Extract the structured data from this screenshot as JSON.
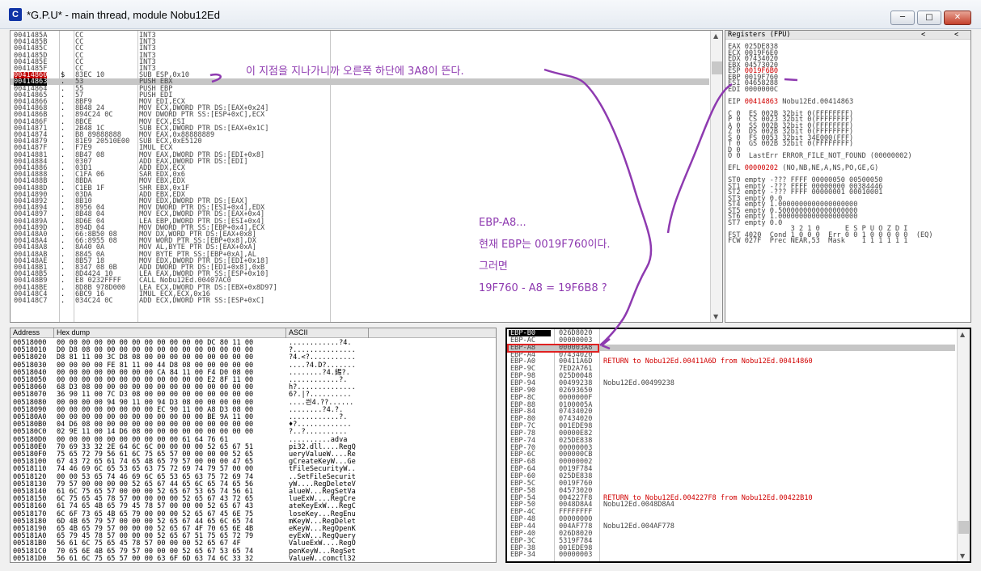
{
  "window": {
    "title": "*G.P.U* - main thread, module Nobu12Ed",
    "icon": "C",
    "min": "─",
    "max": "□",
    "close": "✕"
  },
  "colors": {
    "annotation": "#8e3ab0",
    "red": "#d00000"
  },
  "annotation_top": "이 지점을 지나가니까 오른쪽 하단에 3A8이 뜬다.",
  "annotation_note": [
    "EBP-A8...",
    "현재 EBP는 0019F760이다.",
    "그러면",
    "19F760 - A8 = 19F6B8 ?"
  ],
  "cpu": {
    "rows": [
      {
        "a": "0041485A",
        "m": "",
        "h": "CC",
        "d": "INT3"
      },
      {
        "a": "0041485B",
        "m": "",
        "h": "CC",
        "d": "INT3"
      },
      {
        "a": "0041485C",
        "m": "",
        "h": "CC",
        "d": "INT3"
      },
      {
        "a": "0041485D",
        "m": "",
        "h": "CC",
        "d": "INT3"
      },
      {
        "a": "0041485E",
        "m": "",
        "h": "CC",
        "d": "INT3"
      },
      {
        "a": "0041485F",
        "m": "",
        "h": "CC",
        "d": "INT3"
      },
      {
        "a": "00414860",
        "m": "$",
        "h": "83EC 10",
        "d": "SUB ESP,0x10"
      },
      {
        "a": "00414863",
        "m": ".",
        "h": "53",
        "d": "PUSH EBX"
      },
      {
        "a": "00414864",
        "m": ".",
        "h": "55",
        "d": "PUSH EBP"
      },
      {
        "a": "00414865",
        "m": ".",
        "h": "57",
        "d": "PUSH EDI"
      },
      {
        "a": "00414866",
        "m": ".",
        "h": "8BF9",
        "d": "MOV EDI,ECX"
      },
      {
        "a": "00414868",
        "m": ".",
        "h": "8B48 24",
        "d": "MOV ECX,DWORD PTR DS:[EAX+0x24]"
      },
      {
        "a": "0041486B",
        "m": ".",
        "h": "894C24 0C",
        "d": "MOV DWORD PTR SS:[ESP+0xC],ECX"
      },
      {
        "a": "0041486F",
        "m": ".",
        "h": "8BCE",
        "d": "MOV ECX,ESI"
      },
      {
        "a": "00414871",
        "m": ".",
        "h": "2B48 1C",
        "d": "SUB ECX,DWORD PTR DS:[EAX+0x1C]"
      },
      {
        "a": "00414874",
        "m": ".",
        "h": "B8 89888888",
        "d": "MOV EAX,0x88888889"
      },
      {
        "a": "00414879",
        "m": ".",
        "h": "81E9 20510E00",
        "d": "SUB ECX,0xE5120"
      },
      {
        "a": "0041487F",
        "m": ".",
        "h": "F7E9",
        "d": "IMUL ECX"
      },
      {
        "a": "00414881",
        "m": ".",
        "h": "8B47 08",
        "d": "MOV EAX,DWORD PTR DS:[EDI+0x8]"
      },
      {
        "a": "00414884",
        "m": ".",
        "h": "0307",
        "d": "ADD EAX,DWORD PTR DS:[EDI]"
      },
      {
        "a": "00414886",
        "m": ".",
        "h": "03D1",
        "d": "ADD EDX,ECX"
      },
      {
        "a": "00414888",
        "m": ".",
        "h": "C1FA 06",
        "d": "SAR EDX,0x6"
      },
      {
        "a": "0041488B",
        "m": ".",
        "h": "8BDA",
        "d": "MOV EBX,EDX"
      },
      {
        "a": "0041488D",
        "m": ".",
        "h": "C1EB 1F",
        "d": "SHR EBX,0x1F"
      },
      {
        "a": "00414890",
        "m": ".",
        "h": "03DA",
        "d": "ADD EBX,EDX"
      },
      {
        "a": "00414892",
        "m": ".",
        "h": "8B10",
        "d": "MOV EDX,DWORD PTR DS:[EAX]"
      },
      {
        "a": "00414894",
        "m": ".",
        "h": "8956 04",
        "d": "MOV DWORD PTR DS:[ESI+0x4],EDX"
      },
      {
        "a": "00414897",
        "m": ".",
        "h": "8B48 04",
        "d": "MOV ECX,DWORD PTR DS:[EAX+0x4]"
      },
      {
        "a": "0041489A",
        "m": ".",
        "h": "8D6E 04",
        "d": "LEA EBP,DWORD PTR DS:[ESI+0x4]"
      },
      {
        "a": "0041489D",
        "m": ".",
        "h": "894D 04",
        "d": "MOV DWORD PTR SS:[EBP+0x4],ECX"
      },
      {
        "a": "004148A0",
        "m": ".",
        "h": "66:8B50 08",
        "d": "MOV DX,WORD PTR DS:[EAX+0x8]"
      },
      {
        "a": "004148A4",
        "m": ".",
        "h": "66:8955 08",
        "d": "MOV WORD PTR SS:[EBP+0x8],DX"
      },
      {
        "a": "004148A8",
        "m": ".",
        "h": "8A40 0A",
        "d": "MOV AL,BYTE PTR DS:[EAX+0xA]"
      },
      {
        "a": "004148AB",
        "m": ".",
        "h": "8845 0A",
        "d": "MOV BYTE PTR SS:[EBP+0xA],AL"
      },
      {
        "a": "004148AE",
        "m": ".",
        "h": "8B57 18",
        "d": "MOV EDX,DWORD PTR DS:[EDI+0x18]"
      },
      {
        "a": "004148B1",
        "m": ".",
        "h": "8347 08 0B",
        "d": "ADD DWORD PTR DS:[EDI+0x8],0xB"
      },
      {
        "a": "004148B5",
        "m": ".",
        "h": "8D4424 10",
        "d": "LEA EAX,DWORD PTR SS:[ESP+0x10]"
      },
      {
        "a": "004148B9",
        "m": ".",
        "h": "E8 0232FFFF",
        "d": "CALL Nobu12Ed.00407AC0"
      },
      {
        "a": "004148BE",
        "m": ".",
        "h": "8D8B 978D000",
        "d": "LEA ECX,DWORD PTR DS:[EBX+0x8D97]"
      },
      {
        "a": "004148C4",
        "m": ".",
        "h": "6BC9 16",
        "d": "IMUL ECX,ECX,0x16"
      },
      {
        "a": "004148C7",
        "m": ".",
        "h": "034C24 0C",
        "d": "ADD ECX,DWORD PTR SS:[ESP+0xC]"
      }
    ]
  },
  "registers": {
    "header": "Registers (FPU)",
    "arrow_l": "<",
    "arrow_r": "<",
    "lines": [
      "EAX 025DE838",
      "ECX 0019F6E0",
      "EDX 07434020",
      "EBX 04573020",
      "ESP 0019F6B0",
      "EBP 0019F760",
      "ESI 04658288",
      "EDI 0000000C",
      "",
      "EIP 00414863 Nobu12Ed.00414863",
      "",
      "C 0  ES 002B 32bit 0(FFFFFFFF)",
      "P 0  CS 0023 32bit 0(FFFFFFFF)",
      "A 0  SS 002B 32bit 0(FFFFFFFF)",
      "Z 0  DS 002B 32bit 0(FFFFFFFF)",
      "S 0  FS 0053 32bit 34E000(FFF)",
      "T 0  GS 002B 32bit 0(FFFFFFFF)",
      "D 0",
      "O 0  LastErr ERROR_FILE_NOT_FOUND (00000002)",
      "",
      "EFL 00000202 (NO,NB,NE,A,NS,PO,GE,G)",
      "",
      "ST0 empty -??? FFFF 00000050 00500050",
      "ST1 empty -??? FFFF 00000000 00384446",
      "ST2 empty -??? FFFF 00000001 00010001",
      "ST3 empty 0.0",
      "ST4 empty 1.0000000000000000000",
      "ST5 empty 0.5000000000000000000",
      "ST6 empty 1.0000000000000000000",
      "ST7 empty 0.0",
      "               3 2 1 0      E S P U O Z D I",
      "FST 4020  Cond 1 0 0 0  Err 0 0 1 0 0 0 0 0  (EQ)",
      "FCW 027F  Prec NEAR,53  Mask    1 1 1 1 1 1"
    ]
  },
  "dump": {
    "col_address": "Address",
    "col_hex": "Hex dump",
    "col_ascii": "ASCII",
    "rows": [
      {
        "a": "00518000",
        "h": "00 00 00 00 00 00 00 00 00 00 00 00 DC 80 11 00",
        "s": "............?4."
      },
      {
        "a": "00518010",
        "h": "D0 D8 08 00 00 00 00 00 00 00 00 00 00 00 00 00",
        "s": "?..............."
      },
      {
        "a": "00518020",
        "h": "D8 81 11 00 3C D8 08 00 00 00 00 00 00 00 00 00",
        "s": "?4.<?..........."
      },
      {
        "a": "00518030",
        "h": "00 00 00 00 FE 81 11 00 44 D8 08 00 00 00 00 00",
        "s": "....?4.D?......."
      },
      {
        "a": "00518040",
        "h": "00 00 00 00 00 00 00 00 CA 84 11 00 F4 D0 08 00",
        "s": "........?4.錫?."
      },
      {
        "a": "00518050",
        "h": "00 00 00 00 00 00 00 00 00 00 00 00 E2 8F 11 00",
        "s": "............?."
      },
      {
        "a": "00518060",
        "h": "68 D3 08 00 00 00 00 00 00 00 00 00 00 00 00 00",
        "s": "h?.............."
      },
      {
        "a": "00518070",
        "h": "36 90 11 00 7C D3 08 00 00 00 00 00 00 00 00 00",
        "s": "6?.|?.........."
      },
      {
        "a": "00518080",
        "h": "00 00 00 00 94 90 11 00 94 D3 08 00 00 00 00 00",
        "s": "....씐4.??......"
      },
      {
        "a": "00518090",
        "h": "00 00 00 00 00 00 00 00 EC 90 11 00 A8 D3 08 00",
        "s": "........?4.?."
      },
      {
        "a": "005180A0",
        "h": "00 00 00 00 00 00 00 00 00 00 00 00 BE 9A 11 00",
        "s": "............?."
      },
      {
        "a": "005180B0",
        "h": "04 D6 08 00 00 00 00 00 00 00 00 00 00 00 00 00",
        "s": "♦?............."
      },
      {
        "a": "005180C0",
        "h": "02 9E 11 00 14 D6 08 00 00 00 00 00 00 00 00 00",
        "s": "?..?.........."
      },
      {
        "a": "005180D0",
        "h": "00 00 00 00 00 00 00 00 00 00 61 64 76 61",
        "s": "..........adva"
      },
      {
        "a": "005180E0",
        "h": "70 69 33 32 2E 64 6C 6C 00 00 00 00 52 65 67 51",
        "s": "pi32.dll....RegQ"
      },
      {
        "a": "005180F0",
        "h": "75 65 72 79 56 61 6C 75 65 57 00 00 00 00 52 65",
        "s": "ueryValueW....Re"
      },
      {
        "a": "00518100",
        "h": "67 43 72 65 61 74 65 4B 65 79 57 00 00 00 47 65",
        "s": "gCreateKeyW...Ge"
      },
      {
        "a": "00518110",
        "h": "74 46 69 6C 65 53 65 63 75 72 69 74 79 57 00 00",
        "s": "tFileSecurityW.."
      },
      {
        "a": "00518120",
        "h": "00 00 53 65 74 46 69 6C 65 53 65 63 75 72 69 74",
        "s": "..SetFileSecurit"
      },
      {
        "a": "00518130",
        "h": "79 57 00 00 00 00 52 65 67 44 65 6C 65 74 65 56",
        "s": "yW....RegDeleteV"
      },
      {
        "a": "00518140",
        "h": "61 6C 75 65 57 00 00 00 52 65 67 53 65 74 56 61",
        "s": "alueW...RegSetVa"
      },
      {
        "a": "00518150",
        "h": "6C 75 65 45 78 57 00 00 00 00 52 65 67 43 72 65",
        "s": "lueExW....RegCre"
      },
      {
        "a": "00518160",
        "h": "61 74 65 4B 65 79 45 78 57 00 00 00 52 65 67 43",
        "s": "ateKeyExW...RegC"
      },
      {
        "a": "00518170",
        "h": "6C 6F 73 65 4B 65 79 00 00 00 52 65 67 45 6E 75",
        "s": "loseKey...RegEnu"
      },
      {
        "a": "00518180",
        "h": "6D 4B 65 79 57 00 00 00 52 65 67 44 65 6C 65 74",
        "s": "mKeyW...RegDelet"
      },
      {
        "a": "00518190",
        "h": "65 4B 65 79 57 00 00 00 52 65 67 4F 70 65 6E 4B",
        "s": "eKeyW...RegOpenK"
      },
      {
        "a": "005181A0",
        "h": "65 79 45 78 57 00 00 00 52 65 67 51 75 65 72 79",
        "s": "eyExW...RegQuery"
      },
      {
        "a": "005181B0",
        "h": "56 61 6C 75 65 45 78 57 00 00 00 52 65 67 4F",
        "s": "ValueExW....RegO"
      },
      {
        "a": "005181C0",
        "h": "70 65 6E 4B 65 79 57 00 00 00 52 65 67 53 65 74",
        "s": "penKeyW...RegSet"
      },
      {
        "a": "005181D0",
        "h": "56 61 6C 75 65 57 00 00 63 6F 6D 63 74 6C 33 32",
        "s": "ValueW..comctl32"
      }
    ]
  },
  "stack": {
    "rows": [
      {
        "k": "EBP-B0",
        "v": "026D8020",
        "c": "",
        "red": false
      },
      {
        "k": "EBP-AC",
        "v": "00000003",
        "c": "",
        "red": false
      },
      {
        "k": "EBP-A8",
        "v": "000003A8",
        "c": "",
        "red": false
      },
      {
        "k": "EBP-A4",
        "v": "07434020",
        "c": "",
        "red": false
      },
      {
        "k": "EBP-A0",
        "v": "00411A6D",
        "c": "RETURN to Nobu12Ed.00411A6D from Nobu12Ed.00414860",
        "red": true
      },
      {
        "k": "EBP-9C",
        "v": "7ED2A761",
        "c": "",
        "red": false
      },
      {
        "k": "EBP-98",
        "v": "025D0048",
        "c": "",
        "red": false
      },
      {
        "k": "EBP-94",
        "v": "00499238",
        "c": "Nobu12Ed.00499238",
        "red": false
      },
      {
        "k": "EBP-90",
        "v": "02693650",
        "c": "",
        "red": false
      },
      {
        "k": "EBP-8C",
        "v": "0000000F",
        "c": "",
        "red": false
      },
      {
        "k": "EBP-88",
        "v": "0100005A",
        "c": "",
        "red": false
      },
      {
        "k": "EBP-84",
        "v": "07434020",
        "c": "",
        "red": false
      },
      {
        "k": "EBP-80",
        "v": "07434020",
        "c": "",
        "red": false
      },
      {
        "k": "EBP-7C",
        "v": "001EDE98",
        "c": "",
        "red": false
      },
      {
        "k": "EBP-78",
        "v": "00000E82",
        "c": "",
        "red": false
      },
      {
        "k": "EBP-74",
        "v": "025DE838",
        "c": "",
        "red": false
      },
      {
        "k": "EBP-70",
        "v": "00000003",
        "c": "",
        "red": false
      },
      {
        "k": "EBP-6C",
        "v": "000000CB",
        "c": "",
        "red": false
      },
      {
        "k": "EBP-68",
        "v": "00000002",
        "c": "",
        "red": false
      },
      {
        "k": "EBP-64",
        "v": "0019F784",
        "c": "",
        "red": false
      },
      {
        "k": "EBP-60",
        "v": "025DE838",
        "c": "",
        "red": false
      },
      {
        "k": "EBP-5C",
        "v": "0019F760",
        "c": "",
        "red": false
      },
      {
        "k": "EBP-58",
        "v": "04573020",
        "c": "",
        "red": false
      },
      {
        "k": "EBP-54",
        "v": "004227F8",
        "c": "RETURN to Nobu12Ed.004227F8 from Nobu12Ed.00422B10",
        "red": true
      },
      {
        "k": "EBP-50",
        "v": "0048D8A4",
        "c": "Nobu12Ed.0048D8A4",
        "red": false
      },
      {
        "k": "EBP-4C",
        "v": "FFFFFFFF",
        "c": "",
        "red": false
      },
      {
        "k": "EBP-48",
        "v": "00000000",
        "c": "",
        "red": false
      },
      {
        "k": "EBP-44",
        "v": "004AF778",
        "c": "Nobu12Ed.004AF778",
        "red": false
      },
      {
        "k": "EBP-40",
        "v": "026D8020",
        "c": "",
        "red": false
      },
      {
        "k": "EBP-3C",
        "v": "5319F784",
        "c": "",
        "red": false
      },
      {
        "k": "EBP-38",
        "v": "001EDE98",
        "c": "",
        "red": false
      },
      {
        "k": "EBP-34",
        "v": "00000003",
        "c": "",
        "red": false
      }
    ]
  }
}
